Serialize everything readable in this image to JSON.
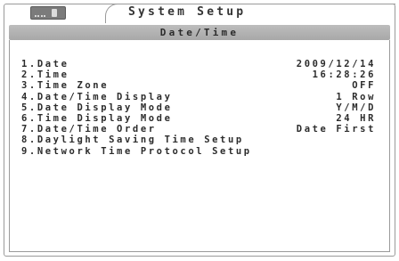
{
  "header": {
    "title": "System Setup",
    "battery_icon": "battery-plug-icon"
  },
  "section": {
    "title": "Date/Time"
  },
  "colors": {
    "background": "#ffffff",
    "subheader_bar": "#b3b3b3",
    "text": "#2c2c2c",
    "battery": "#7b7b7b"
  },
  "menu": {
    "items": [
      {
        "label": "1.Date",
        "value": "2009/12/14"
      },
      {
        "label": "2.Time",
        "value": "16:28:26"
      },
      {
        "label": "3.Time Zone",
        "value": "OFF"
      },
      {
        "label": "4.Date/Time Display",
        "value": "1 Row"
      },
      {
        "label": "5.Date Display Mode",
        "value": "Y/M/D"
      },
      {
        "label": "6.Time Display Mode",
        "value": "24 HR"
      },
      {
        "label": "7.Date/Time Order",
        "value": "Date First"
      },
      {
        "label": "8.Daylight Saving Time Setup",
        "value": ""
      },
      {
        "label": "9.Network Time Protocol Setup",
        "value": ""
      }
    ]
  }
}
